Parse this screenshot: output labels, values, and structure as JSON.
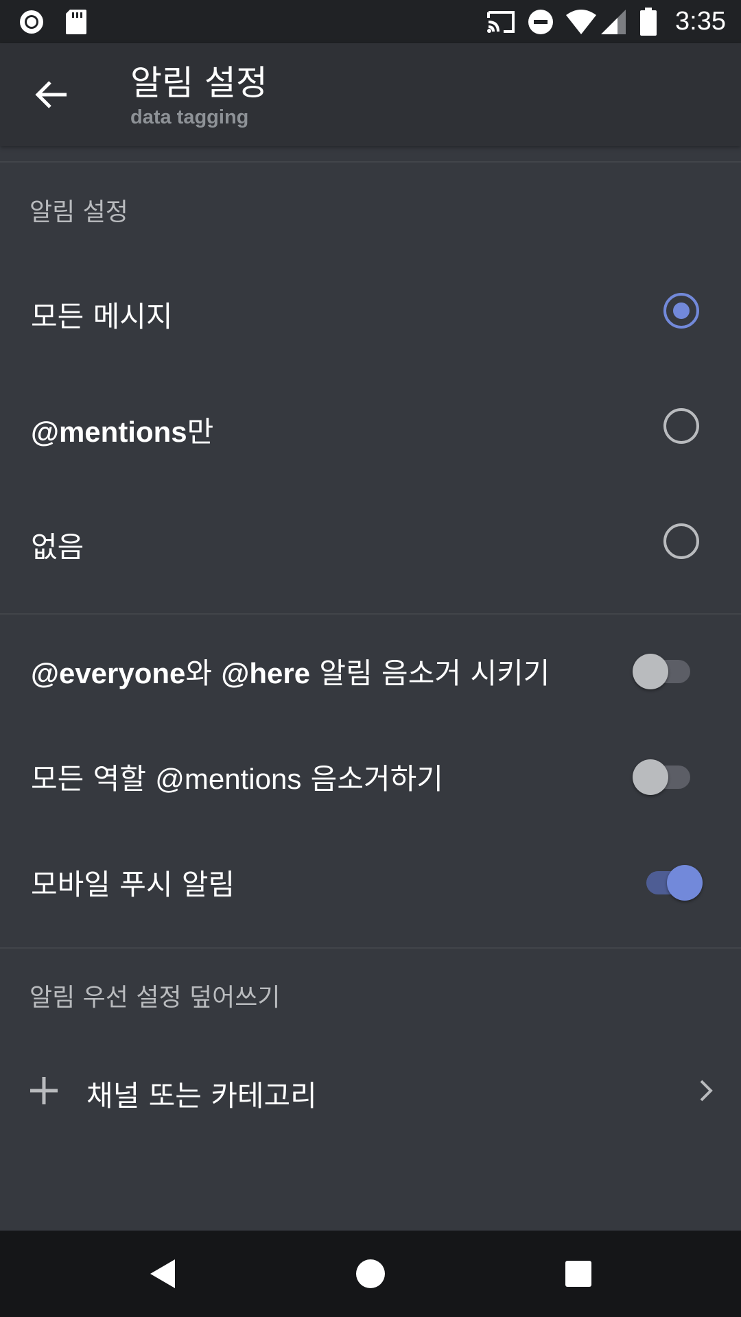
{
  "status_bar": {
    "time": "3:35",
    "icons": [
      "record-icon",
      "sd-card-icon",
      "cast-icon",
      "do-not-disturb-icon",
      "wifi-icon",
      "signal-icon",
      "battery-icon"
    ]
  },
  "app_bar": {
    "title": "알림 설정",
    "subtitle": "data tagging"
  },
  "sections": {
    "notification_settings": {
      "header": "알림 설정",
      "options": [
        {
          "label": "모든 메시지",
          "selected": true
        },
        {
          "label_bold": "@mentions",
          "label_rest": "만",
          "selected": false
        },
        {
          "label": "없음",
          "selected": false
        }
      ]
    },
    "toggles": [
      {
        "bold1": "@everyone",
        "mid": "와 ",
        "bold2": "@here",
        "rest": " 알림 음소거 시키기",
        "on": false
      },
      {
        "pre": "모든 역할 ",
        "latin": "@mentions",
        "rest": " 음소거하기",
        "on": false
      },
      {
        "label": "모바일 푸시 알림",
        "on": true
      }
    ],
    "overrides": {
      "header": "알림 우선 설정 덮어쓰기",
      "add_label": "채널 또는 카테고리"
    }
  },
  "colors": {
    "background": "#36393f",
    "app_bar": "#2f3136",
    "accent": "#7289da",
    "muted_text": "#b9bbbe"
  }
}
